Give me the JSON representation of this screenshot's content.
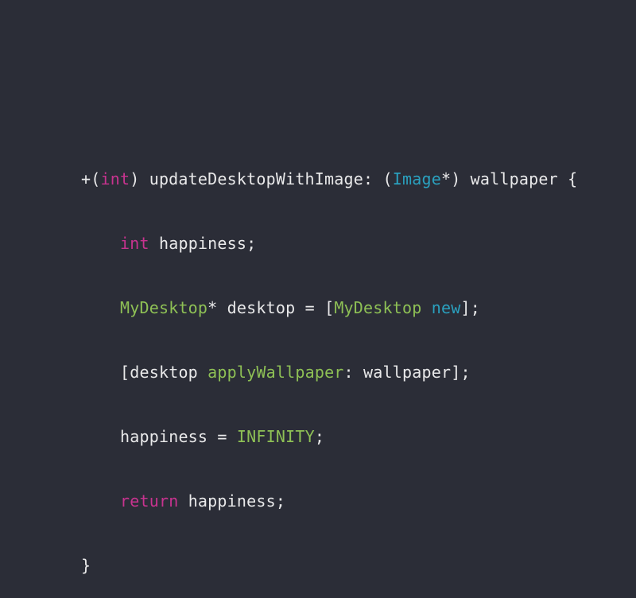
{
  "colors": {
    "background": "#2b2d37",
    "text": "#e9e9ea",
    "keyword": "#c8338f",
    "type": "#2aa0be",
    "class_name": "#8ec055"
  },
  "code": {
    "line1": {
      "prefix": "+(",
      "return_type": "int",
      "method_start": ") updateDesktopWithImage: (",
      "param_type": "Image",
      "method_end": "*) wallpaper {"
    },
    "line2": {
      "type": "int",
      "rest": " happiness;"
    },
    "line3": {
      "class1": "MyDesktop",
      "mid": "* desktop = [",
      "class2": "MyDesktop",
      "space": " ",
      "msg": "new",
      "end": "];"
    },
    "line4": {
      "start": "[desktop ",
      "msg": "applyWallpaper",
      "end": ": wallpaper];"
    },
    "line5": {
      "start": "happiness = ",
      "const": "INFINITY",
      "end": ";"
    },
    "line6": {
      "keyword": "return",
      "rest": " happiness;"
    },
    "line7": {
      "brace": "}"
    }
  }
}
